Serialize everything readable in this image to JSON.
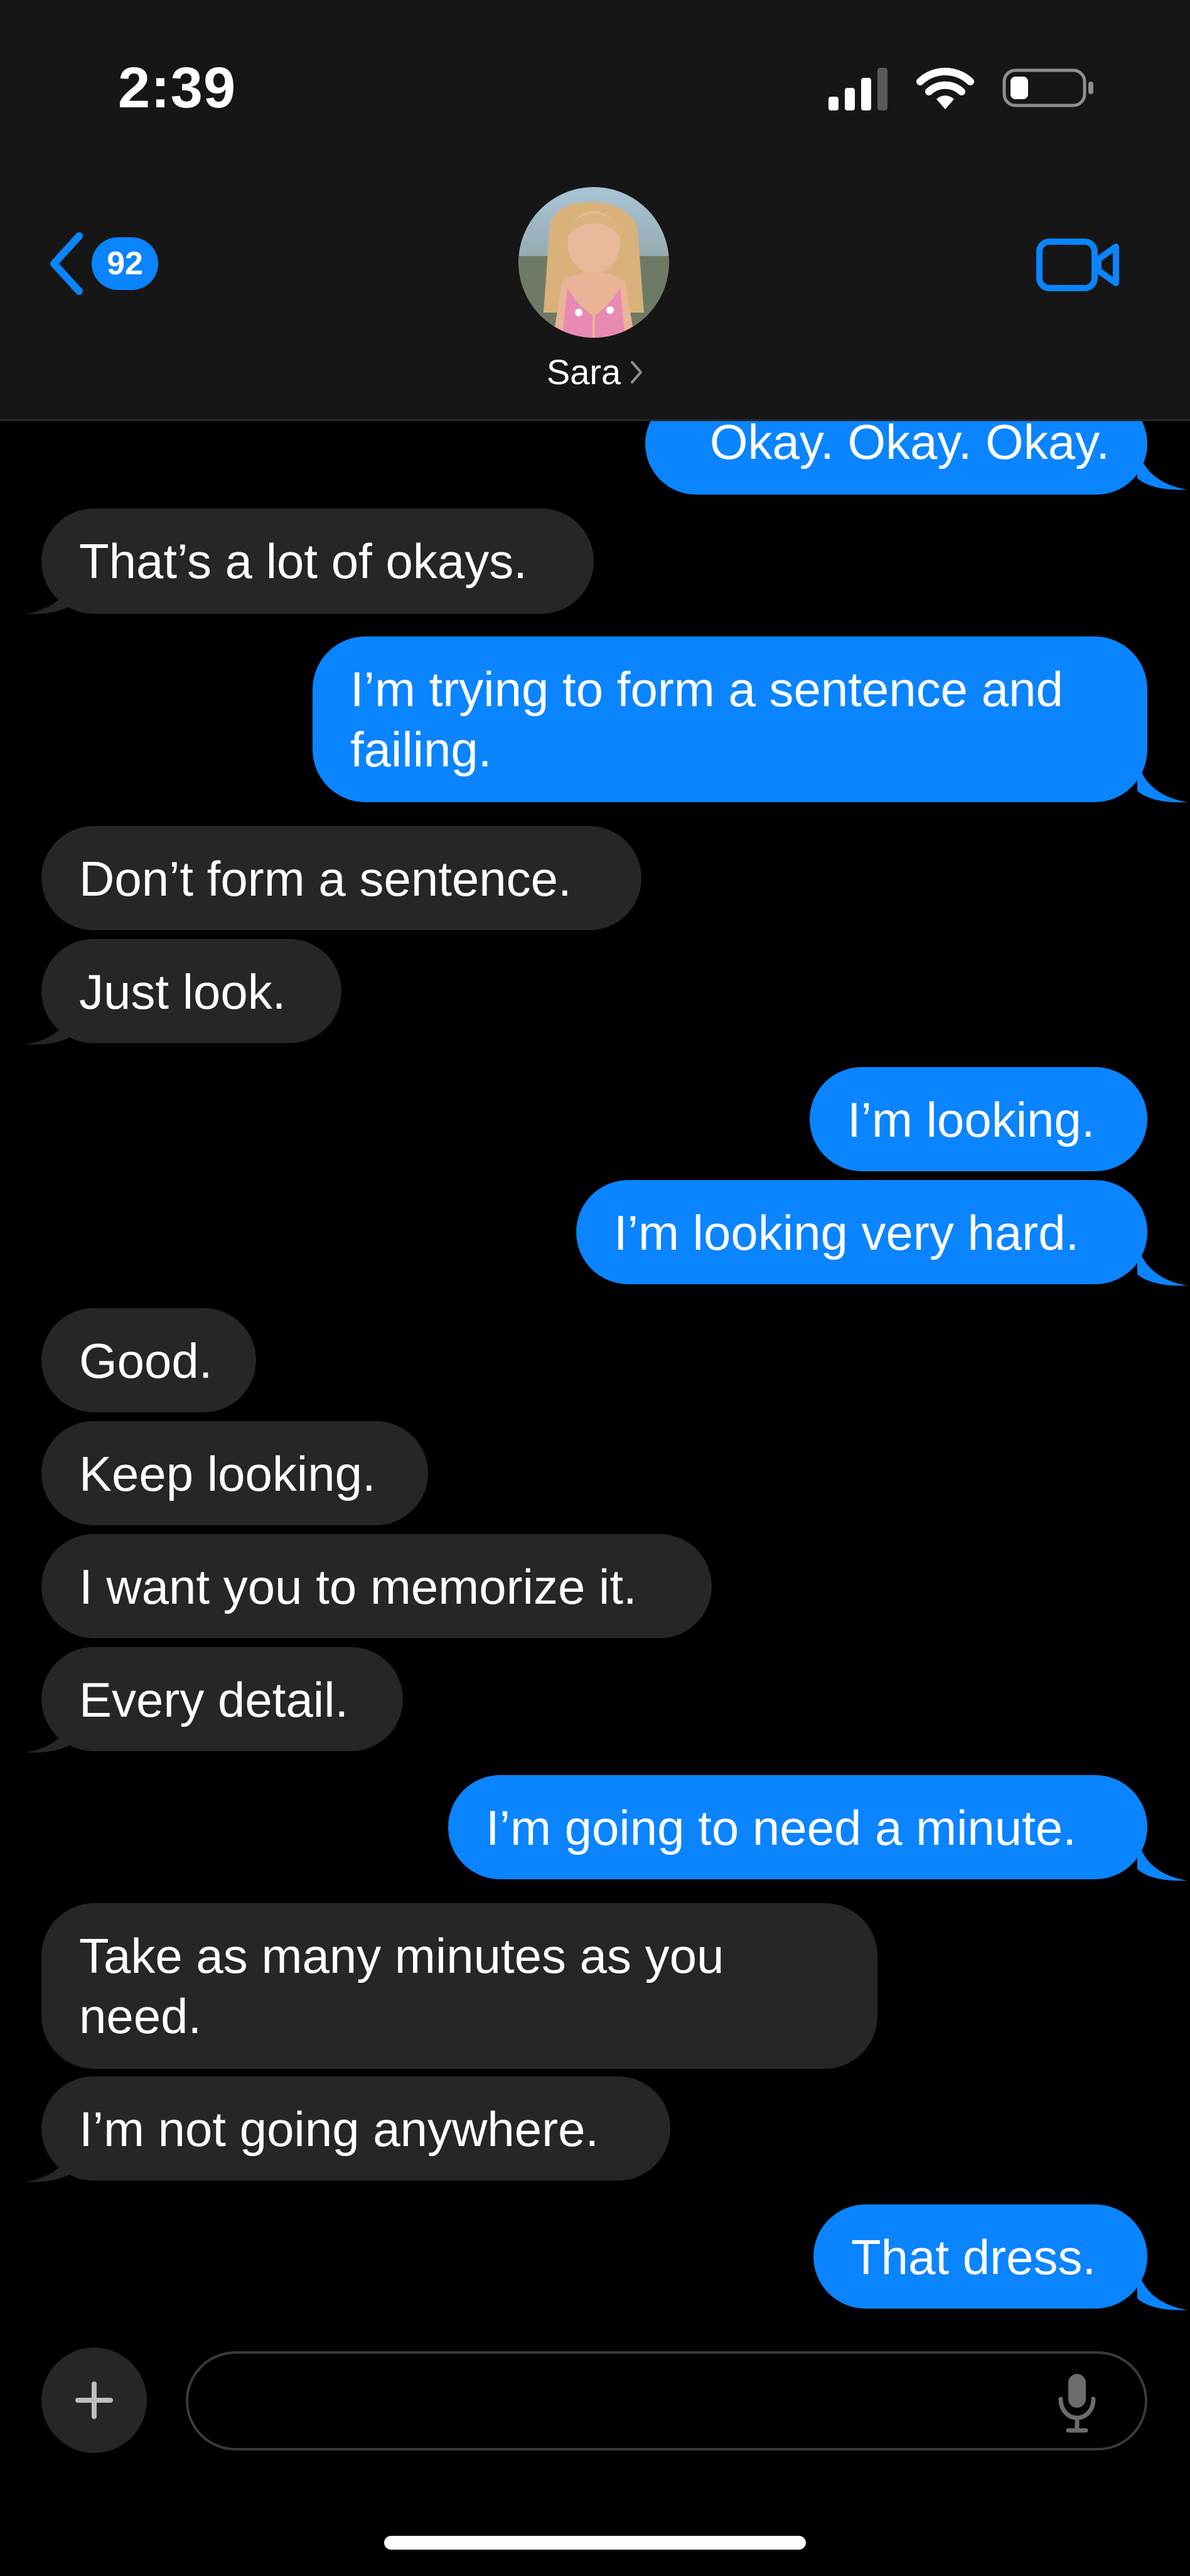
{
  "status_bar": {
    "time": "2:39"
  },
  "header": {
    "back_badge_count": "92",
    "contact_name": "Sara"
  },
  "messages": [
    {
      "direction": "outgoing",
      "text": "Okay. Okay. Okay."
    },
    {
      "direction": "incoming",
      "text": "That’s a lot of okays."
    },
    {
      "direction": "outgoing",
      "text": "I’m trying to form a sentence and failing."
    },
    {
      "direction": "incoming",
      "text": "Don’t form a sentence."
    },
    {
      "direction": "incoming",
      "text": "Just look."
    },
    {
      "direction": "outgoing",
      "text": "I’m looking."
    },
    {
      "direction": "outgoing",
      "text": "I’m looking very hard."
    },
    {
      "direction": "incoming",
      "text": "Good."
    },
    {
      "direction": "incoming",
      "text": "Keep looking."
    },
    {
      "direction": "incoming",
      "text": "I want you to memorize it."
    },
    {
      "direction": "incoming",
      "text": "Every detail."
    },
    {
      "direction": "outgoing",
      "text": "I’m going to need a minute."
    },
    {
      "direction": "incoming",
      "text": "Take as many minutes as you need."
    },
    {
      "direction": "incoming",
      "text": "I’m not going anywhere."
    },
    {
      "direction": "outgoing",
      "text": "That dress."
    }
  ],
  "input": {
    "value": "",
    "placeholder": ""
  },
  "icons": {
    "back": "chevron-left-icon",
    "video": "video-camera-icon",
    "plus": "plus-icon",
    "mic": "microphone-icon",
    "signal": "cellular-signal-icon",
    "wifi": "wifi-icon",
    "battery": "battery-icon"
  },
  "colors": {
    "accent": "#0a84ff",
    "incoming_bubble": "#262628",
    "background": "#000000",
    "header": "#161616"
  }
}
